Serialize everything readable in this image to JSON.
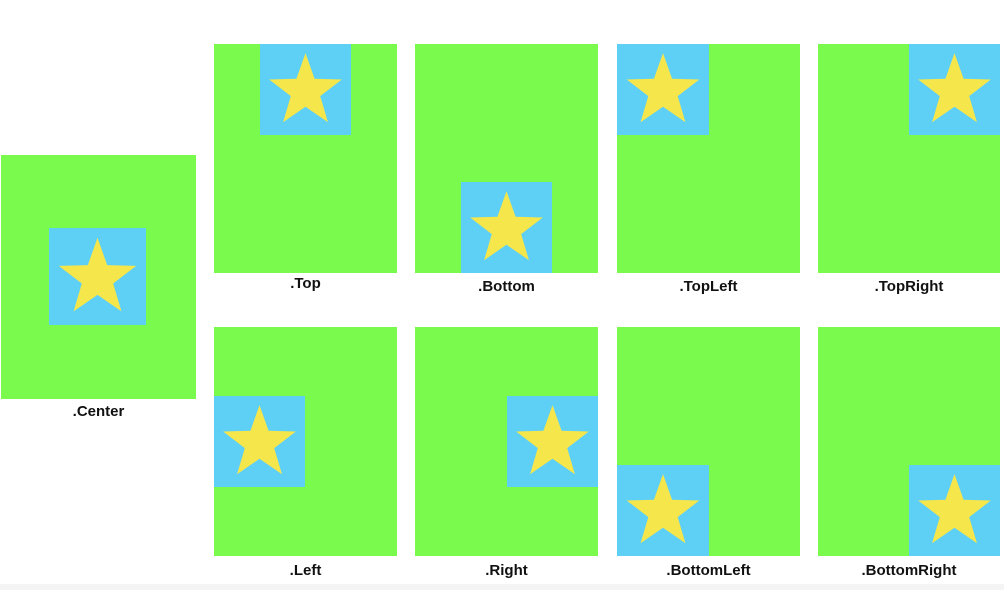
{
  "colors": {
    "frame": "#7afa4c",
    "tile": "#5ecff5",
    "star": "#f5e64c"
  },
  "icons": {
    "star": "star-icon"
  },
  "examples": [
    {
      "id": "center",
      "label": ".Center"
    },
    {
      "id": "top",
      "label": ".Top"
    },
    {
      "id": "bottom",
      "label": ".Bottom"
    },
    {
      "id": "topleft",
      "label": ".TopLeft"
    },
    {
      "id": "topright",
      "label": ".TopRight"
    },
    {
      "id": "left",
      "label": ".Left"
    },
    {
      "id": "right",
      "label": ".Right"
    },
    {
      "id": "bottomleft",
      "label": ".BottomLeft"
    },
    {
      "id": "bottomright",
      "label": ".BottomRight"
    }
  ]
}
